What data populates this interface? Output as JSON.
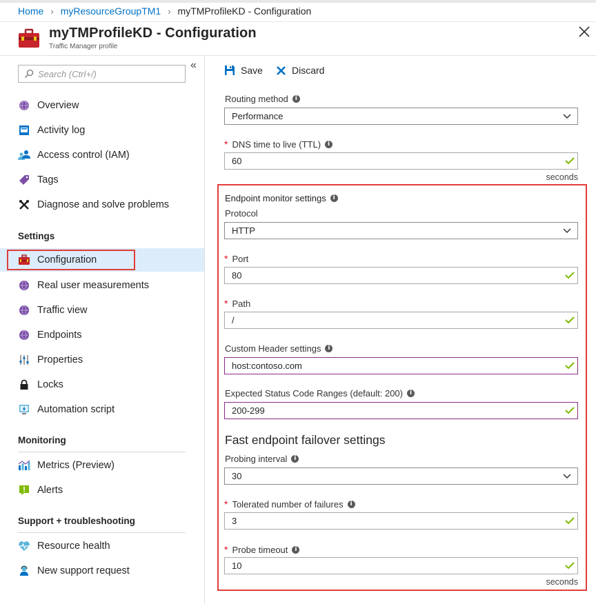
{
  "breadcrumb": {
    "items": [
      "Home",
      "myResourceGroupTM1"
    ],
    "current": "myTMProfileKD - Configuration"
  },
  "header": {
    "title": "myTMProfileKD - Configuration",
    "subtitle": "Traffic Manager profile"
  },
  "sidebar": {
    "search_placeholder": "Search (Ctrl+/)",
    "collapse_glyph": "«",
    "top_items": [
      {
        "label": "Overview",
        "icon": "globe-icon"
      },
      {
        "label": "Activity log",
        "icon": "activity-log-icon"
      },
      {
        "label": "Access control (IAM)",
        "icon": "people-icon"
      },
      {
        "label": "Tags",
        "icon": "tag-icon"
      },
      {
        "label": "Diagnose and solve problems",
        "icon": "tools-icon"
      }
    ],
    "sections": {
      "settings": "Settings",
      "monitoring": "Monitoring",
      "support": "Support + troubleshooting"
    },
    "settings_items": [
      {
        "label": "Configuration",
        "icon": "toolbox-icon",
        "active": true
      },
      {
        "label": "Real user measurements",
        "icon": "globe-icon"
      },
      {
        "label": "Traffic view",
        "icon": "globe-icon"
      },
      {
        "label": "Endpoints",
        "icon": "globe-icon"
      },
      {
        "label": "Properties",
        "icon": "sliders-icon"
      },
      {
        "label": "Locks",
        "icon": "lock-icon"
      },
      {
        "label": "Automation script",
        "icon": "script-icon"
      }
    ],
    "monitoring_items": [
      {
        "label": "Metrics (Preview)",
        "icon": "chart-icon"
      },
      {
        "label": "Alerts",
        "icon": "alert-icon"
      }
    ],
    "support_items": [
      {
        "label": "Resource health",
        "icon": "heartbeat-icon"
      },
      {
        "label": "New support request",
        "icon": "support-person-icon"
      }
    ]
  },
  "toolbar": {
    "save_label": "Save",
    "discard_label": "Discard"
  },
  "form": {
    "routing_method": {
      "label": "Routing method",
      "value": "Performance"
    },
    "dns_ttl": {
      "label": "DNS time to live (TTL)",
      "value": "60",
      "unit": "seconds"
    },
    "endpoint_monitor": {
      "heading": "Endpoint monitor settings",
      "protocol": {
        "label": "Protocol",
        "value": "HTTP"
      },
      "port": {
        "label": "Port",
        "value": "80"
      },
      "path": {
        "label": "Path",
        "value": "/"
      },
      "custom_header": {
        "label": "Custom Header settings",
        "value": "host:contoso.com"
      },
      "status_codes": {
        "label": "Expected Status Code Ranges (default: 200)",
        "value": "200-299"
      }
    },
    "fast_failover": {
      "heading": "Fast endpoint failover settings",
      "probing_interval": {
        "label": "Probing interval",
        "value": "30"
      },
      "tolerated_failures": {
        "label": "Tolerated number of failures",
        "value": "3"
      },
      "probe_timeout": {
        "label": "Probe timeout",
        "value": "10",
        "unit": "seconds"
      }
    }
  },
  "colors": {
    "link": "#0072c6",
    "required_asterisk": "#e00b1c",
    "valid_check": "#7fba00",
    "highlight_border": "#e23c3c",
    "active_nav_bg": "#dcecfa"
  }
}
